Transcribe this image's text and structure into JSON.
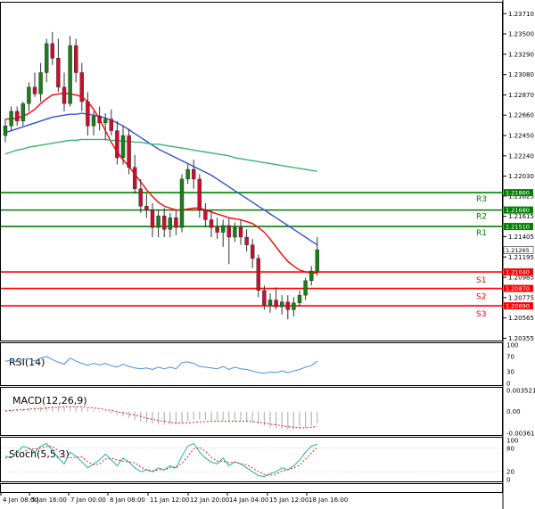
{
  "chart_data": {
    "type": "candlestick",
    "instrument_levels": [
      {
        "label": "R3",
        "value": 1.2186,
        "tag": "1.21860",
        "color": "#008000"
      },
      {
        "label": "R2",
        "value": 1.2168,
        "tag": "1.21680",
        "color": "#008000"
      },
      {
        "label": "R1",
        "value": 1.2151,
        "tag": "1.21510",
        "color": "#008000"
      },
      {
        "label": "S1",
        "value": 1.2104,
        "tag": "1.21040",
        "color": "#ff0000"
      },
      {
        "label": "S2",
        "value": 1.2087,
        "tag": "1.20870",
        "color": "#ff0000"
      },
      {
        "label": "S3",
        "value": 1.2069,
        "tag": "1.20690",
        "color": "#ff0000"
      }
    ],
    "price_ticks": [
      "1.23710",
      "1.23500",
      "1.23290",
      "1.23080",
      "1.22870",
      "1.22660",
      "1.22450",
      "1.22240",
      "1.22030",
      "1.21825",
      "1.21615",
      "1.21405",
      "1.21195",
      "1.20985",
      "1.20775",
      "1.20565",
      "1.20355"
    ],
    "price_range": [
      1.2035,
      1.2374
    ],
    "current_price": "1.21265",
    "extra_ticks": [
      "1.21615",
      "1.21825"
    ],
    "x_labels": [
      "4 Jan 08:00",
      "5 Jan 16:00",
      "7 Jan 00:00",
      "8 Jan 08:00",
      "11 Jan 12:00",
      "12 Jan 20:00",
      "14 Jan 04:00",
      "15 Jan 12:00",
      "18 Jan 16:00"
    ],
    "candles": [
      {
        "o": 1.2245,
        "h": 1.2262,
        "l": 1.2238,
        "c": 1.2255
      },
      {
        "o": 1.2255,
        "h": 1.2275,
        "l": 1.225,
        "c": 1.227
      },
      {
        "o": 1.227,
        "h": 1.2275,
        "l": 1.2255,
        "c": 1.226
      },
      {
        "o": 1.226,
        "h": 1.228,
        "l": 1.2255,
        "c": 1.2278
      },
      {
        "o": 1.2278,
        "h": 1.23,
        "l": 1.227,
        "c": 1.2295
      },
      {
        "o": 1.2295,
        "h": 1.231,
        "l": 1.2285,
        "c": 1.2288
      },
      {
        "o": 1.2288,
        "h": 1.232,
        "l": 1.228,
        "c": 1.231
      },
      {
        "o": 1.231,
        "h": 1.2345,
        "l": 1.23,
        "c": 1.234
      },
      {
        "o": 1.234,
        "h": 1.2352,
        "l": 1.2318,
        "c": 1.2325
      },
      {
        "o": 1.2325,
        "h": 1.2345,
        "l": 1.229,
        "c": 1.2295
      },
      {
        "o": 1.2295,
        "h": 1.231,
        "l": 1.227,
        "c": 1.2278
      },
      {
        "o": 1.2278,
        "h": 1.2348,
        "l": 1.2275,
        "c": 1.2338
      },
      {
        "o": 1.2338,
        "h": 1.2345,
        "l": 1.23,
        "c": 1.231
      },
      {
        "o": 1.231,
        "h": 1.232,
        "l": 1.227,
        "c": 1.228
      },
      {
        "o": 1.228,
        "h": 1.229,
        "l": 1.2245,
        "c": 1.2255
      },
      {
        "o": 1.2255,
        "h": 1.227,
        "l": 1.2245,
        "c": 1.2265
      },
      {
        "o": 1.2265,
        "h": 1.2275,
        "l": 1.225,
        "c": 1.2258
      },
      {
        "o": 1.2258,
        "h": 1.2268,
        "l": 1.224,
        "c": 1.2262
      },
      {
        "o": 1.2262,
        "h": 1.2272,
        "l": 1.2245,
        "c": 1.225
      },
      {
        "o": 1.225,
        "h": 1.226,
        "l": 1.2215,
        "c": 1.2222
      },
      {
        "o": 1.2222,
        "h": 1.2255,
        "l": 1.2215,
        "c": 1.2245
      },
      {
        "o": 1.2245,
        "h": 1.2252,
        "l": 1.2205,
        "c": 1.2212
      },
      {
        "o": 1.2212,
        "h": 1.2225,
        "l": 1.2185,
        "c": 1.219
      },
      {
        "o": 1.219,
        "h": 1.22,
        "l": 1.2165,
        "c": 1.2172
      },
      {
        "o": 1.2172,
        "h": 1.2185,
        "l": 1.216,
        "c": 1.2168
      },
      {
        "o": 1.2168,
        "h": 1.2175,
        "l": 1.214,
        "c": 1.215
      },
      {
        "o": 1.215,
        "h": 1.2168,
        "l": 1.214,
        "c": 1.2162
      },
      {
        "o": 1.2162,
        "h": 1.217,
        "l": 1.214,
        "c": 1.2148
      },
      {
        "o": 1.2148,
        "h": 1.2165,
        "l": 1.214,
        "c": 1.216
      },
      {
        "o": 1.216,
        "h": 1.2168,
        "l": 1.2142,
        "c": 1.215
      },
      {
        "o": 1.215,
        "h": 1.2205,
        "l": 1.2145,
        "c": 1.22
      },
      {
        "o": 1.22,
        "h": 1.2215,
        "l": 1.2195,
        "c": 1.221
      },
      {
        "o": 1.221,
        "h": 1.222,
        "l": 1.219,
        "c": 1.22
      },
      {
        "o": 1.22,
        "h": 1.2205,
        "l": 1.216,
        "c": 1.2168
      },
      {
        "o": 1.2168,
        "h": 1.2175,
        "l": 1.215,
        "c": 1.2158
      },
      {
        "o": 1.2158,
        "h": 1.2168,
        "l": 1.214,
        "c": 1.215
      },
      {
        "o": 1.215,
        "h": 1.216,
        "l": 1.2138,
        "c": 1.2145
      },
      {
        "o": 1.2145,
        "h": 1.2158,
        "l": 1.213,
        "c": 1.2152
      },
      {
        "o": 1.2152,
        "h": 1.216,
        "l": 1.2112,
        "c": 1.214
      },
      {
        "o": 1.214,
        "h": 1.2155,
        "l": 1.2135,
        "c": 1.215
      },
      {
        "o": 1.215,
        "h": 1.2158,
        "l": 1.2132,
        "c": 1.214
      },
      {
        "o": 1.214,
        "h": 1.2148,
        "l": 1.2125,
        "c": 1.2132
      },
      {
        "o": 1.2132,
        "h": 1.2138,
        "l": 1.2108,
        "c": 1.2118
      },
      {
        "o": 1.2118,
        "h": 1.2122,
        "l": 1.2078,
        "c": 1.2085
      },
      {
        "o": 1.2085,
        "h": 1.209,
        "l": 1.2065,
        "c": 1.207
      },
      {
        "o": 1.207,
        "h": 1.2082,
        "l": 1.2062,
        "c": 1.2075
      },
      {
        "o": 1.2075,
        "h": 1.2088,
        "l": 1.2065,
        "c": 1.2068
      },
      {
        "o": 1.2068,
        "h": 1.208,
        "l": 1.206,
        "c": 1.2073
      },
      {
        "o": 1.2073,
        "h": 1.208,
        "l": 1.2055,
        "c": 1.2065
      },
      {
        "o": 1.2065,
        "h": 1.2078,
        "l": 1.2058,
        "c": 1.2072
      },
      {
        "o": 1.2072,
        "h": 1.2085,
        "l": 1.2068,
        "c": 1.208
      },
      {
        "o": 1.208,
        "h": 1.2098,
        "l": 1.2075,
        "c": 1.2095
      },
      {
        "o": 1.2095,
        "h": 1.211,
        "l": 1.209,
        "c": 1.2105
      },
      {
        "o": 1.2105,
        "h": 1.214,
        "l": 1.21,
        "c": 1.2127
      }
    ],
    "moving_averages": [
      {
        "color": "#ff0000",
        "values": [
          1.2262,
          1.2262,
          1.2263,
          1.2265,
          1.2268,
          1.2272,
          1.2278,
          1.2283,
          1.2287,
          1.2288,
          1.2289,
          1.2288,
          1.2287,
          1.2285,
          1.228,
          1.2272,
          1.2262,
          1.225,
          1.2238,
          1.2228,
          1.222,
          1.2213,
          1.2205,
          1.2197,
          1.2189,
          1.2182,
          1.2176,
          1.2172,
          1.217,
          1.2168,
          1.2168,
          1.2169,
          1.217,
          1.217,
          1.2168,
          1.2166,
          1.2164,
          1.2162,
          1.216,
          1.2159,
          1.2158,
          1.2156,
          1.2154,
          1.215,
          1.2145,
          1.2138,
          1.213,
          1.2122,
          1.2115,
          1.211,
          1.2106,
          1.2104,
          1.2103,
          1.2103
        ]
      },
      {
        "color": "#3050d8",
        "values": [
          1.2248,
          1.225,
          1.2252,
          1.2254,
          1.2256,
          1.2258,
          1.226,
          1.2262,
          1.2264,
          1.2265,
          1.2266,
          1.2267,
          1.2267,
          1.2268,
          1.2267,
          1.2266,
          1.2265,
          1.2263,
          1.2261,
          1.2258,
          1.2255,
          1.2251,
          1.2247,
          1.2243,
          1.2239,
          1.2235,
          1.2231,
          1.2228,
          1.2225,
          1.2222,
          1.2219,
          1.2216,
          1.2213,
          1.221,
          1.2207,
          1.2204,
          1.22,
          1.2196,
          1.2192,
          1.2188,
          1.2184,
          1.218,
          1.2176,
          1.2172,
          1.2168,
          1.2164,
          1.216,
          1.2156,
          1.2152,
          1.2148,
          1.2144,
          1.214,
          1.2136,
          1.2132
        ]
      },
      {
        "color": "#3cb371",
        "values": [
          1.2226,
          1.2228,
          1.223,
          1.2231,
          1.2233,
          1.2234,
          1.2235,
          1.2236,
          1.2237,
          1.2238,
          1.2239,
          1.224,
          1.224,
          1.2241,
          1.2241,
          1.2241,
          1.2241,
          1.2241,
          1.224,
          1.224,
          1.2239,
          1.2239,
          1.2238,
          1.2238,
          1.2237,
          1.2236,
          1.2236,
          1.2235,
          1.2234,
          1.2233,
          1.2232,
          1.2231,
          1.223,
          1.2229,
          1.2228,
          1.2227,
          1.2226,
          1.2225,
          1.2224,
          1.2222,
          1.2221,
          1.222,
          1.2219,
          1.2218,
          1.2217,
          1.2216,
          1.2215,
          1.2214,
          1.2213,
          1.2212,
          1.2211,
          1.221,
          1.2209,
          1.2208
        ]
      }
    ],
    "rsi": {
      "label": "RSI(14)",
      "ticks": [
        "100",
        "70",
        "30",
        "0"
      ],
      "values": [
        58,
        60,
        56,
        62,
        65,
        58,
        66,
        70,
        62,
        55,
        50,
        66,
        58,
        52,
        47,
        52,
        48,
        52,
        46,
        42,
        50,
        44,
        40,
        38,
        40,
        36,
        42,
        38,
        42,
        38,
        54,
        56,
        52,
        44,
        42,
        40,
        38,
        44,
        36,
        42,
        38,
        36,
        32,
        28,
        26,
        30,
        28,
        32,
        28,
        32,
        36,
        42,
        46,
        58
      ]
    },
    "macd": {
      "label": "MACD(12,26,9)",
      "ticks": [
        "0.003521",
        "0.00",
        "-0.003613"
      ],
      "range": [
        -0.003613,
        0.003521
      ],
      "hist": [
        0.0002,
        0.0003,
        0.0004,
        0.0005,
        0.0006,
        0.0006,
        0.0007,
        0.0008,
        0.0009,
        0.0009,
        0.0008,
        0.0009,
        0.0008,
        0.0007,
        0.0005,
        0.0003,
        0.0001,
        -0.0001,
        -0.0003,
        -0.0006,
        -0.0008,
        -0.0011,
        -0.0014,
        -0.0017,
        -0.0019,
        -0.0021,
        -0.0022,
        -0.0022,
        -0.0022,
        -0.0022,
        -0.0019,
        -0.0016,
        -0.0014,
        -0.0014,
        -0.0014,
        -0.0015,
        -0.0015,
        -0.0015,
        -0.0016,
        -0.0016,
        -0.0016,
        -0.0017,
        -0.0018,
        -0.0021,
        -0.0024,
        -0.0026,
        -0.0028,
        -0.0029,
        -0.003,
        -0.003,
        -0.0029,
        -0.0027,
        -0.0024,
        -0.002
      ],
      "signal": [
        0.0001,
        0.0002,
        0.0003,
        0.0003,
        0.0004,
        0.0005,
        0.0005,
        0.0006,
        0.0007,
        0.0007,
        0.0008,
        0.0008,
        0.0008,
        0.0008,
        0.0007,
        0.0006,
        0.0005,
        0.0003,
        0.0002,
        0.0,
        -0.0002,
        -0.0004,
        -0.0006,
        -0.0008,
        -0.0011,
        -0.0013,
        -0.0015,
        -0.0016,
        -0.0018,
        -0.0019,
        -0.0019,
        -0.0019,
        -0.0018,
        -0.0017,
        -0.0017,
        -0.0016,
        -0.0016,
        -0.0016,
        -0.0016,
        -0.0016,
        -0.0016,
        -0.0016,
        -0.0017,
        -0.0018,
        -0.0019,
        -0.0021,
        -0.0022,
        -0.0024,
        -0.0025,
        -0.0026,
        -0.0027,
        -0.0027,
        -0.0026,
        -0.0025
      ]
    },
    "stoch": {
      "label": "Stoch(5,5,3)",
      "ticks": [
        "100",
        "80",
        "20",
        "0"
      ],
      "k": [
        60,
        55,
        70,
        85,
        80,
        70,
        85,
        92,
        75,
        55,
        40,
        70,
        60,
        45,
        30,
        40,
        50,
        65,
        50,
        35,
        55,
        45,
        30,
        20,
        25,
        20,
        30,
        25,
        35,
        30,
        60,
        85,
        92,
        70,
        55,
        45,
        40,
        55,
        35,
        45,
        40,
        30,
        20,
        10,
        8,
        15,
        20,
        30,
        25,
        35,
        50,
        70,
        85,
        90
      ],
      "d": [
        55,
        57,
        62,
        70,
        78,
        78,
        80,
        85,
        84,
        74,
        57,
        55,
        57,
        58,
        45,
        38,
        40,
        52,
        55,
        50,
        47,
        45,
        43,
        32,
        25,
        22,
        25,
        25,
        30,
        30,
        42,
        58,
        79,
        82,
        72,
        57,
        47,
        47,
        43,
        45,
        40,
        38,
        30,
        20,
        13,
        11,
        14,
        22,
        25,
        30,
        37,
        52,
        68,
        82
      ]
    }
  }
}
